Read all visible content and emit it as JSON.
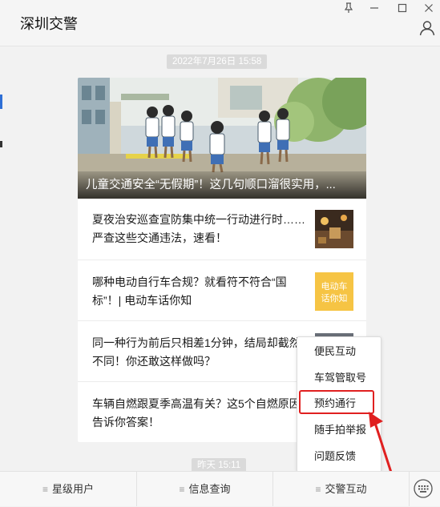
{
  "window": {
    "title": "深圳交警"
  },
  "timestamps": {
    "first": "2022年7月26日  15:58",
    "second": "昨天  15:11"
  },
  "hero": {
    "caption": "儿童交通安全“无假期”！这几句顺口溜很实用，..."
  },
  "articles": [
    {
      "title": "夏夜治安巡查宣防集中统一行动进行时……严查这些交通违法，速看！"
    },
    {
      "title": "哪种电动自行车合规？就看符不符合“国标”！| 电动车话你知",
      "thumb_text": "电动车话你知"
    },
    {
      "title": "同一种行为前后只相差1分钟，结局却截然不同！你还敢这样做吗？"
    },
    {
      "title": "车辆自燃跟夏季高温有关？这5个自燃原因告诉你答案！"
    }
  ],
  "popup_menu": {
    "items": [
      "便民互动",
      "车驾管取号",
      "预约通行",
      "随手拍举报",
      "问题反馈"
    ],
    "highlighted": "预约通行"
  },
  "bottom_tabs": [
    "星级用户",
    "信息查询",
    "交警互动"
  ],
  "colors": {
    "highlight": "#e02020",
    "chip": "#dadada",
    "background": "#f2f2f2"
  },
  "icons": {
    "pin": "pin-icon",
    "minimize": "minimize-icon",
    "maximize": "maximize-icon",
    "close": "close-icon",
    "profile": "person-icon",
    "keyboard": "keyboard-icon"
  }
}
